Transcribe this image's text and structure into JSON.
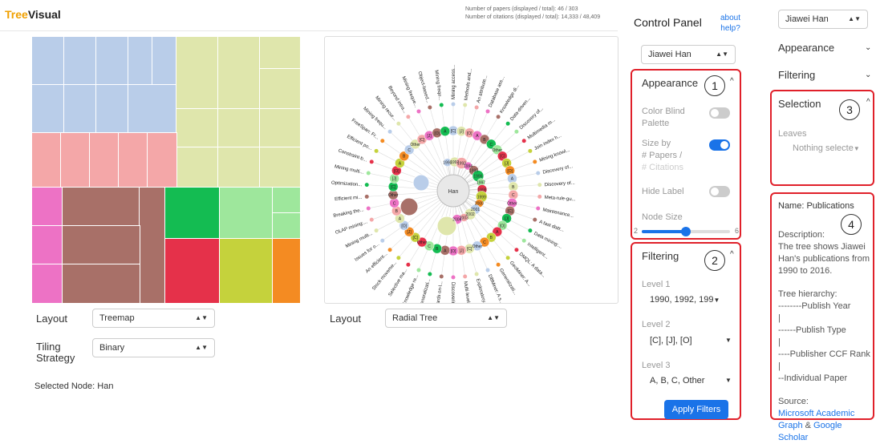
{
  "app": {
    "brand_part1": "Tree",
    "brand_part2": "Visual"
  },
  "stats": {
    "papers": "Number of papers (displayed / total): 46 / 303",
    "citations": "Number of citations (displayed / total): 14,333 / 48,409"
  },
  "left_controls": {
    "layout_label": "Layout",
    "layout_value": "Treemap",
    "tiling_label_1": "Tiling",
    "tiling_label_2": "Strategy",
    "tiling_value": "Binary",
    "selected_node": "Selected Node: Han"
  },
  "right_controls": {
    "layout_label": "Layout",
    "layout_value": "Radial Tree"
  },
  "control_panel": {
    "title": "Control Panel",
    "about_1": "about",
    "about_2": "help?",
    "author": "Jiawei Han",
    "appearance": {
      "title": "Appearance",
      "marker": "1",
      "color_blind_1": "Color Blind",
      "color_blind_2": "Palette",
      "size_by_1": "Size by",
      "size_by_2": "# Papers /",
      "size_by_3": "# Citations",
      "hide_label": "Hide Label",
      "node_size": "Node Size",
      "node_min": "2",
      "node_max": "6",
      "node_value": 4
    },
    "filtering": {
      "title": "Filtering",
      "marker": "2",
      "level1_label": "Level 1",
      "level1_value": "1990, 1992, 199",
      "level2_label": "Level 2",
      "level2_value": "[C], [J], [O]",
      "level3_label": "Level 3",
      "level3_value": "A, B, C, Other",
      "apply": "Apply Filters"
    }
  },
  "side_panel": {
    "author": "Jiawei Han",
    "appearance": "Appearance",
    "filtering": "Filtering",
    "selection": {
      "title": "Selection",
      "marker": "3",
      "leaves_label": "Leaves",
      "leaves_placeholder": "Nothing selecte"
    },
    "info": {
      "marker": "4",
      "name": "Name: Publications",
      "desc_title": "Description:",
      "desc_1": "The tree shows Jiawei",
      "desc_2": "Han's publications from",
      "desc_3": "1990 to 2016.",
      "hier_title": "Tree hierarchy:",
      "h1": "--------Publish Year",
      "p1": "|",
      "h2": "------Publish Type",
      "p2": "|",
      "h3": "----Publisher CCF Rank",
      "p3": "|",
      "h4": "--Individual Paper",
      "source_title": "Source:",
      "src_link1a": "Microsoft Academic",
      "src_link1b": "Graph",
      "src_amp": " & ",
      "src_link2": "Google Scholar"
    }
  },
  "radial": {
    "root": "Han",
    "years": [
      "1990",
      "1992",
      "1993",
      "1994",
      "1995",
      "1996",
      "1997",
      "1998",
      "1999",
      "2000",
      "2001",
      "2002",
      "2003",
      "2004"
    ],
    "level_labels": [
      "[C]",
      "[J]",
      "[O]",
      "A",
      "B",
      "C",
      "Other"
    ],
    "leaf_labels": [
      "Mining access...",
      "Methods and...",
      "An attribute...",
      "Database ass...",
      "Knowledge di...",
      "Data-driven...",
      "Discovery of...",
      "Multimedia m...",
      "Join index h...",
      "Mining knowl...",
      "Discovery of...",
      "Discovery of...",
      "Meta-rule-gu...",
      "Maintenance...",
      "A fast distr...",
      "Data mining:...",
      "Intelligent...",
      "DMQL: A data...",
      "GeoMiner: A...",
      "Generalizati...",
      "DBMiner: A s...",
      "Exploratory...",
      "Multi-level M...",
      "Discovering...",
      "Towards on-l...",
      "Generalizati...",
      "Knowledge re...",
      "Selective ma...",
      "Stock moveme...",
      "An efficient...",
      "Issues for o...",
      "Mining multi...",
      "OLAP mining:...",
      "Breaking the...",
      "Efficient mi...",
      "Optimization...",
      "Mining multi...",
      "Constraint-b...",
      "Efficient po...",
      "FreeSpan: Fr...",
      "Mining frequ...",
      "Mining recur...",
      "Beyond intra...",
      "Mining freque...",
      "Object-based...",
      "Mining frequ..."
    ]
  },
  "colors": {
    "accent": "#1a73e8",
    "highlight": "#e0202a",
    "brand": "#f0a000"
  }
}
